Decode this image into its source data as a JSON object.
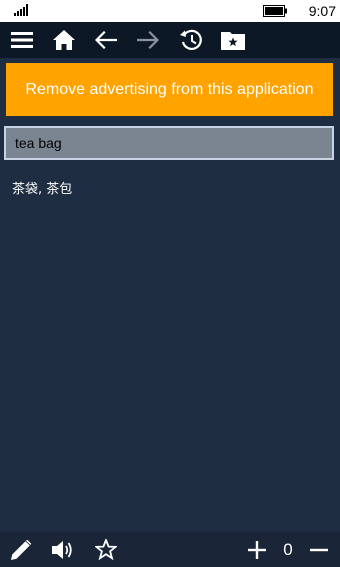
{
  "status_bar": {
    "time": "9:07",
    "icons": [
      "signal-icon",
      "battery-icon"
    ]
  },
  "toolbar": {
    "buttons": [
      {
        "name": "menu",
        "icon": "hamburger-menu-icon"
      },
      {
        "name": "home",
        "icon": "home-icon"
      },
      {
        "name": "back",
        "icon": "arrow-left-icon"
      },
      {
        "name": "forward",
        "icon": "arrow-right-icon"
      },
      {
        "name": "history",
        "icon": "history-icon"
      },
      {
        "name": "favorites",
        "icon": "folder-star-icon"
      }
    ]
  },
  "ad_banner": {
    "text": "Remove advertising from this application"
  },
  "search": {
    "value": "tea bag"
  },
  "translation": {
    "text": "茶袋, 茶包"
  },
  "bottom_bar": {
    "counter": "0",
    "buttons": [
      {
        "name": "edit",
        "icon": "pencil-icon"
      },
      {
        "name": "speak",
        "icon": "speaker-icon"
      },
      {
        "name": "favorite",
        "icon": "star-outline-icon"
      },
      {
        "name": "increase",
        "icon": "plus-icon"
      },
      {
        "name": "decrease",
        "icon": "minus-icon"
      }
    ]
  },
  "colors": {
    "background": "#1f2d42",
    "toolbar": "#0d1826",
    "accent": "#ffa300",
    "input_background": "#7b8591",
    "input_border": "#c7d3e3"
  }
}
